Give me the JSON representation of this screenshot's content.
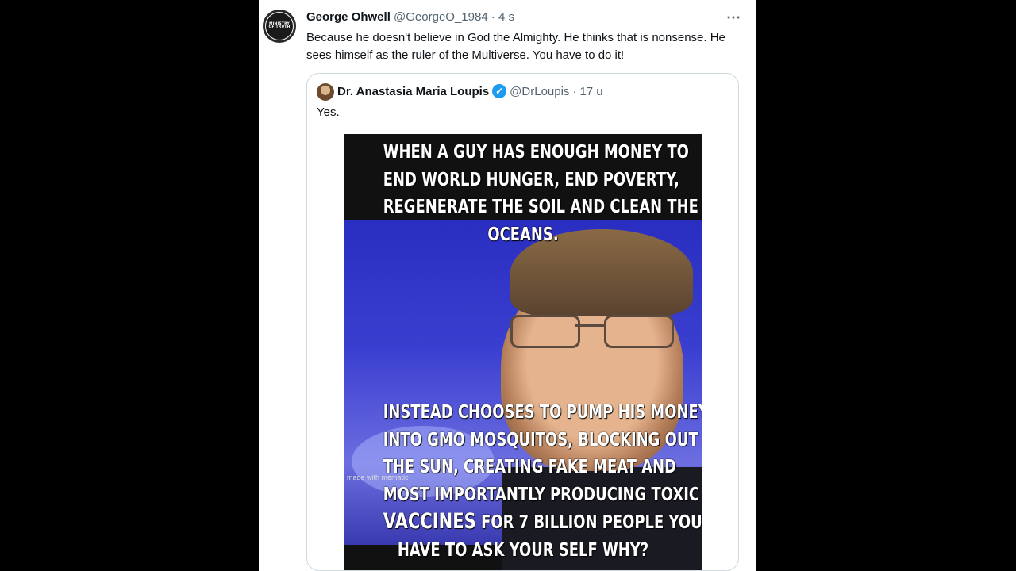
{
  "tweet": {
    "author_name": "George Ohwell",
    "author_handle": "@GeorgeO_1984",
    "separator": "·",
    "time": "4 s",
    "more_icon": "⋯",
    "avatar_label": "MINISTRY OF TRUTH",
    "text": "Because he doesn't believe in God the Almighty. He thinks that is nonsense. He sees himself as the ruler of the Multiverse. You have to do it!"
  },
  "quote": {
    "author_name": "Dr. Anastasia Maria Loupis",
    "verified_icon": "✓",
    "author_handle": "@DrLoupis",
    "separator": "·",
    "time": "17 u",
    "text": "Yes."
  },
  "meme": {
    "top_lines": [
      "WHEN A GUY HAS ENOUGH MONEY TO",
      "END WORLD HUNGER, END POVERTY,",
      "REGENERATE THE SOIL AND CLEAN THE",
      "OCEANS."
    ],
    "bottom_lines": [
      "INSTEAD CHOOSES TO PUMP HIS MONEY",
      "INTO GMO MOSQUITOS, BLOCKING OUT",
      "THE SUN, CREATING FAKE MEAT AND",
      "MOST IMPORTANTLY PRODUCING TOXIC"
    ],
    "last_line_emphasis": "VACCINES",
    "last_line_rest": " FOR 7 BILLION PEOPLE YOU",
    "final_line": "HAVE TO ASK YOUR SELF WHY?",
    "watermark": "made with mematic"
  }
}
